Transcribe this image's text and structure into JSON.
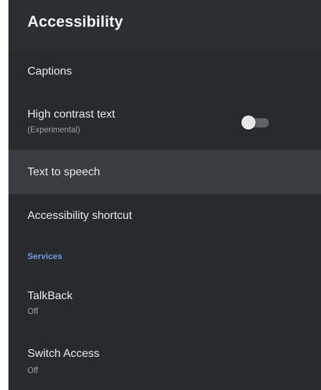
{
  "header": {
    "title": "Accessibility"
  },
  "items": [
    {
      "label": "Captions"
    },
    {
      "label": "High contrast text",
      "sublabel": "(Experimental)",
      "toggle_state": "off"
    },
    {
      "label": "Text to speech"
    },
    {
      "label": "Accessibility shortcut"
    }
  ],
  "services": {
    "header": "Services",
    "items": [
      {
        "label": "TalkBack",
        "sublabel": "Off"
      },
      {
        "label": "Switch Access",
        "sublabel": "Off"
      }
    ]
  },
  "colors": {
    "panel_background": "#282b2e",
    "focused_row": "#393d41",
    "section_accent": "#6f9be0",
    "toggle_track": "#5f6368"
  }
}
